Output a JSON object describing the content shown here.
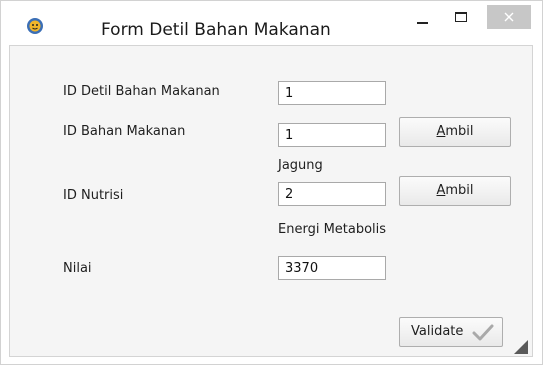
{
  "window": {
    "title": "Form Detil Bahan Makanan",
    "app_icon": "app-gear-face-icon",
    "controls": {
      "minimize": "minimize-icon",
      "maximize": "maximize-icon",
      "close": "close-icon"
    }
  },
  "form": {
    "detil_id": {
      "label": "ID Detil Bahan Makanan",
      "value": "1"
    },
    "bahan_id": {
      "label": "ID Bahan Makanan",
      "value": "1",
      "button_mnemonic": "A",
      "button_rest": "mbil",
      "resolved_name": "Jagung"
    },
    "nutrisi_id": {
      "label": "ID Nutrisi",
      "value": "2",
      "button_mnemonic": "A",
      "button_rest": "mbil",
      "resolved_name": "Energi Metabolis"
    },
    "nilai": {
      "label": "Nilai",
      "value": "3370"
    },
    "validate_label": "Validate",
    "validate_icon": "checkmark-icon"
  },
  "colors": {
    "close_button": "#c7c7c7",
    "checkmark": "#a9a9a9"
  }
}
